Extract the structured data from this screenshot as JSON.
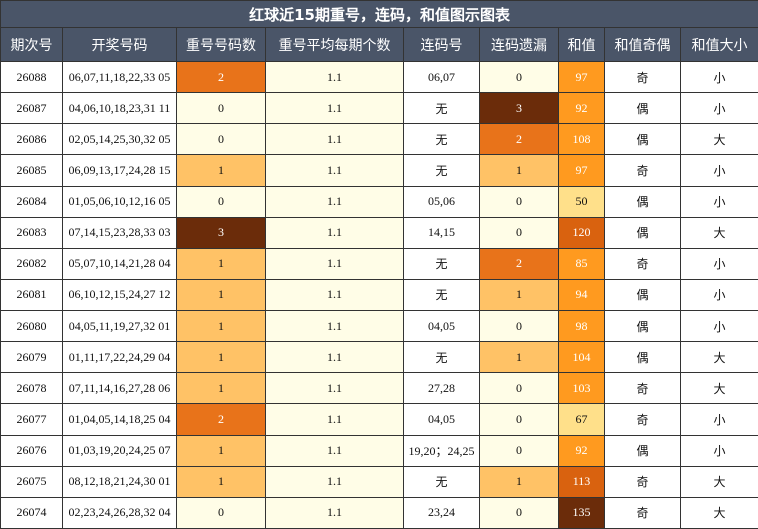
{
  "title": "红球近15期重号，连码，和值图示图表",
  "headers": [
    "期次号",
    "开奖号码",
    "重号号码数",
    "重号平均每期个数",
    "连码号",
    "连码遗漏",
    "和值",
    "和值奇偶",
    "和值大小"
  ],
  "colors": {
    "header_bg": "#4a5568",
    "cream": "#fffde7",
    "repeat": {
      "0": "#fffde7",
      "1": "#ffc266",
      "2": "#e8731a",
      "3": "#6b2c0a"
    },
    "miss": {
      "0": "#fffde7",
      "1": "#ffc266",
      "2": "#e8731a",
      "3": "#6b2c0a"
    },
    "sum_scale": [
      {
        "max": 69,
        "color": "#ffe08a"
      },
      {
        "max": 99,
        "color": "#ff9a1f"
      },
      {
        "max": 109,
        "color": "#ff9a1f"
      },
      {
        "max": 129,
        "color": "#d9620f"
      },
      {
        "max": 999,
        "color": "#6b2c0a"
      }
    ]
  },
  "rows": [
    {
      "issue": "26088",
      "numbers": "06,07,11,18,22,33 05",
      "repeat": "2",
      "avg": "1.1",
      "consecutive": "06,07",
      "miss": "0",
      "sum": "97",
      "parity": "奇",
      "size": "小"
    },
    {
      "issue": "26087",
      "numbers": "04,06,10,18,23,31 11",
      "repeat": "0",
      "avg": "1.1",
      "consecutive": "无",
      "miss": "3",
      "sum": "92",
      "parity": "偶",
      "size": "小"
    },
    {
      "issue": "26086",
      "numbers": "02,05,14,25,30,32 05",
      "repeat": "0",
      "avg": "1.1",
      "consecutive": "无",
      "miss": "2",
      "sum": "108",
      "parity": "偶",
      "size": "大"
    },
    {
      "issue": "26085",
      "numbers": "06,09,13,17,24,28 15",
      "repeat": "1",
      "avg": "1.1",
      "consecutive": "无",
      "miss": "1",
      "sum": "97",
      "parity": "奇",
      "size": "小"
    },
    {
      "issue": "26084",
      "numbers": "01,05,06,10,12,16 05",
      "repeat": "0",
      "avg": "1.1",
      "consecutive": "05,06",
      "miss": "0",
      "sum": "50",
      "parity": "偶",
      "size": "小"
    },
    {
      "issue": "26083",
      "numbers": "07,14,15,23,28,33 03",
      "repeat": "3",
      "avg": "1.1",
      "consecutive": "14,15",
      "miss": "0",
      "sum": "120",
      "parity": "偶",
      "size": "大"
    },
    {
      "issue": "26082",
      "numbers": "05,07,10,14,21,28 04",
      "repeat": "1",
      "avg": "1.1",
      "consecutive": "无",
      "miss": "2",
      "sum": "85",
      "parity": "奇",
      "size": "小"
    },
    {
      "issue": "26081",
      "numbers": "06,10,12,15,24,27 12",
      "repeat": "1",
      "avg": "1.1",
      "consecutive": "无",
      "miss": "1",
      "sum": "94",
      "parity": "偶",
      "size": "小"
    },
    {
      "issue": "26080",
      "numbers": "04,05,11,19,27,32 01",
      "repeat": "1",
      "avg": "1.1",
      "consecutive": "04,05",
      "miss": "0",
      "sum": "98",
      "parity": "偶",
      "size": "小"
    },
    {
      "issue": "26079",
      "numbers": "01,11,17,22,24,29 04",
      "repeat": "1",
      "avg": "1.1",
      "consecutive": "无",
      "miss": "1",
      "sum": "104",
      "parity": "偶",
      "size": "大"
    },
    {
      "issue": "26078",
      "numbers": "07,11,14,16,27,28 06",
      "repeat": "1",
      "avg": "1.1",
      "consecutive": "27,28",
      "miss": "0",
      "sum": "103",
      "parity": "奇",
      "size": "大"
    },
    {
      "issue": "26077",
      "numbers": "01,04,05,14,18,25 04",
      "repeat": "2",
      "avg": "1.1",
      "consecutive": "04,05",
      "miss": "0",
      "sum": "67",
      "parity": "奇",
      "size": "小"
    },
    {
      "issue": "26076",
      "numbers": "01,03,19,20,24,25 07",
      "repeat": "1",
      "avg": "1.1",
      "consecutive": "19,20；24,25",
      "miss": "0",
      "sum": "92",
      "parity": "偶",
      "size": "小"
    },
    {
      "issue": "26075",
      "numbers": "08,12,18,21,24,30 01",
      "repeat": "1",
      "avg": "1.1",
      "consecutive": "无",
      "miss": "1",
      "sum": "113",
      "parity": "奇",
      "size": "大"
    },
    {
      "issue": "26074",
      "numbers": "02,23,24,26,28,32 04",
      "repeat": "0",
      "avg": "1.1",
      "consecutive": "23,24",
      "miss": "0",
      "sum": "135",
      "parity": "奇",
      "size": "大"
    }
  ]
}
